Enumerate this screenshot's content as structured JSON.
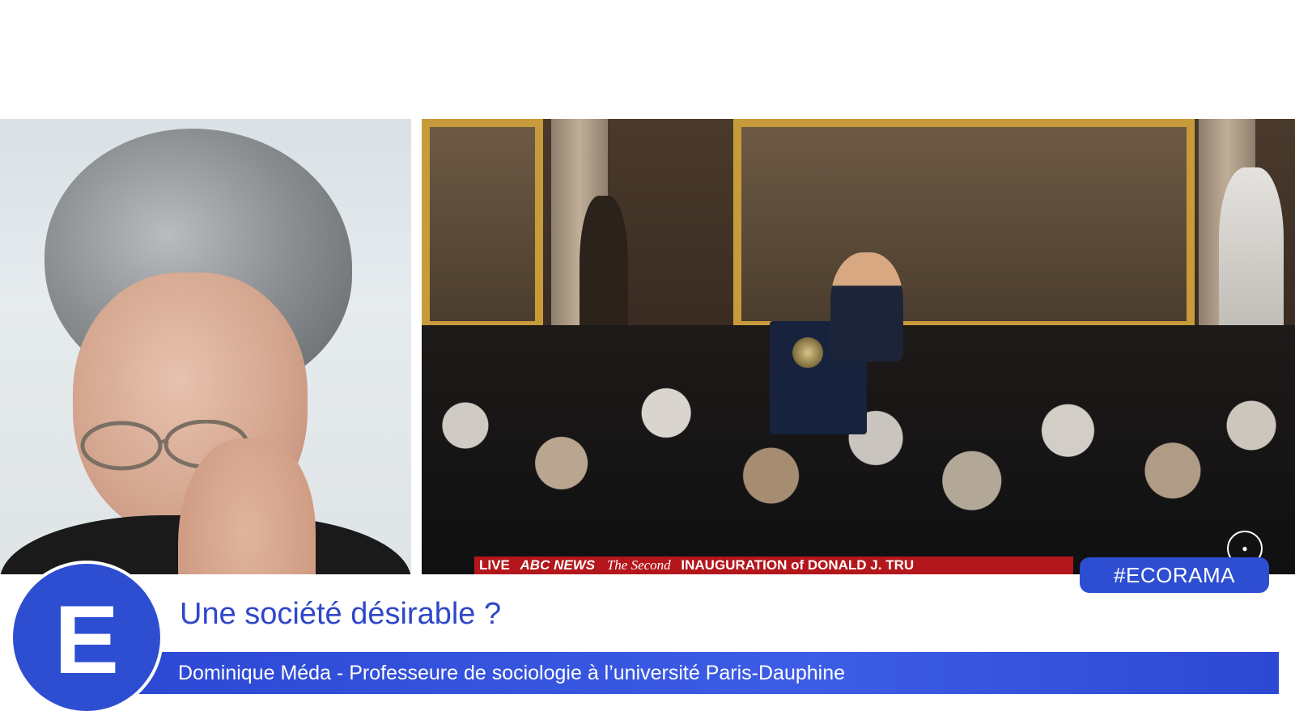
{
  "program": {
    "hashtag": "#ECORAMA",
    "logo_letter": "E"
  },
  "lower_third": {
    "title": "Une société désirable ?",
    "subtitle": "Dominique Méda - Professeure de sociologie à l’université Paris-Dauphine"
  },
  "video_feed": {
    "ticker_live": "LIVE",
    "ticker_network": "ABC NEWS",
    "ticker_second": "The Second",
    "ticker_headline": "INAUGURATION of DONALD J. TRU"
  },
  "colors": {
    "brand_blue": "#2e4ed1",
    "title_blue": "#2f47c9",
    "ticker_red": "#b3161b"
  }
}
